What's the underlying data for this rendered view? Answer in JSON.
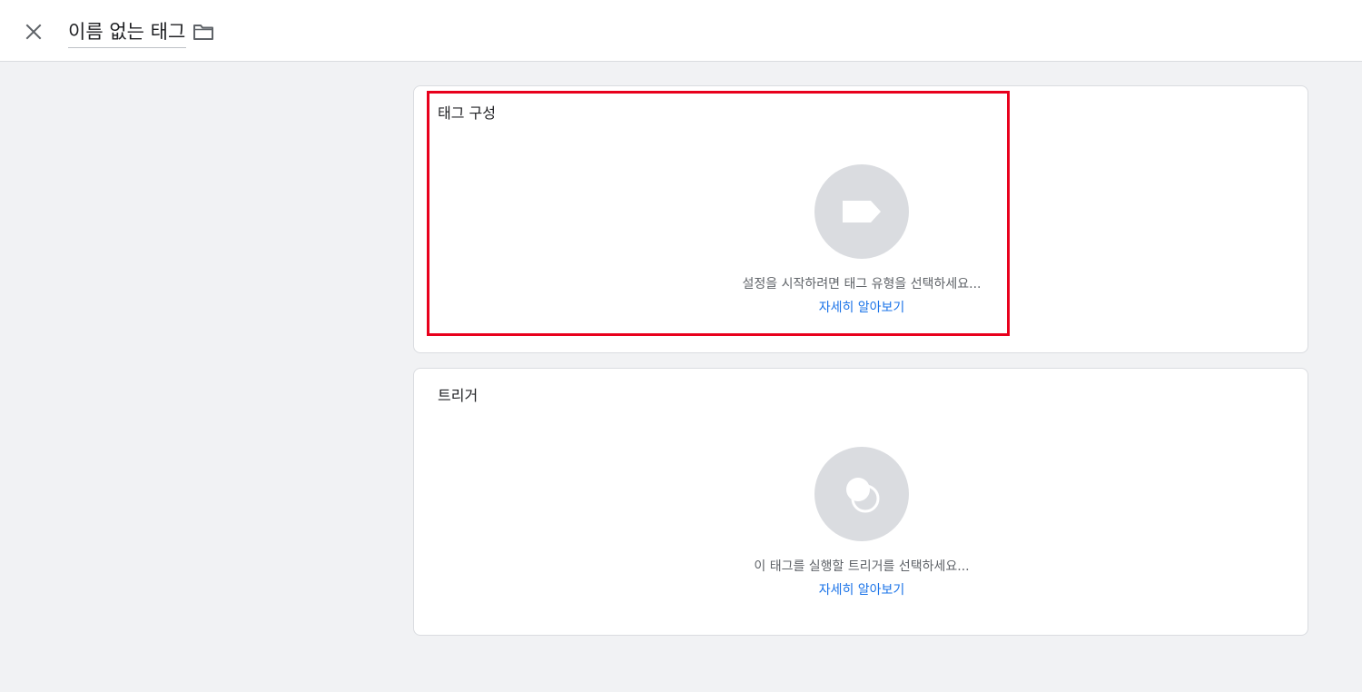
{
  "header": {
    "close_icon": "close-icon",
    "tag_name": "이름 없는 태그",
    "folder_icon": "folder-icon"
  },
  "tag_config": {
    "title": "태그 구성",
    "icon": "tag-icon",
    "prompt": "설정을 시작하려면 태그 유형을 선택하세요...",
    "learn_more": "자세히 알아보기"
  },
  "trigger": {
    "title": "트리거",
    "icon": "trigger-icon",
    "prompt": "이 태그를 실행할 트리거를 선택하세요...",
    "learn_more": "자세히 알아보기"
  },
  "colors": {
    "accent": "#1a73e8",
    "highlight": "#e8001c",
    "placeholder": "#dadce0",
    "background": "#f1f2f4"
  }
}
